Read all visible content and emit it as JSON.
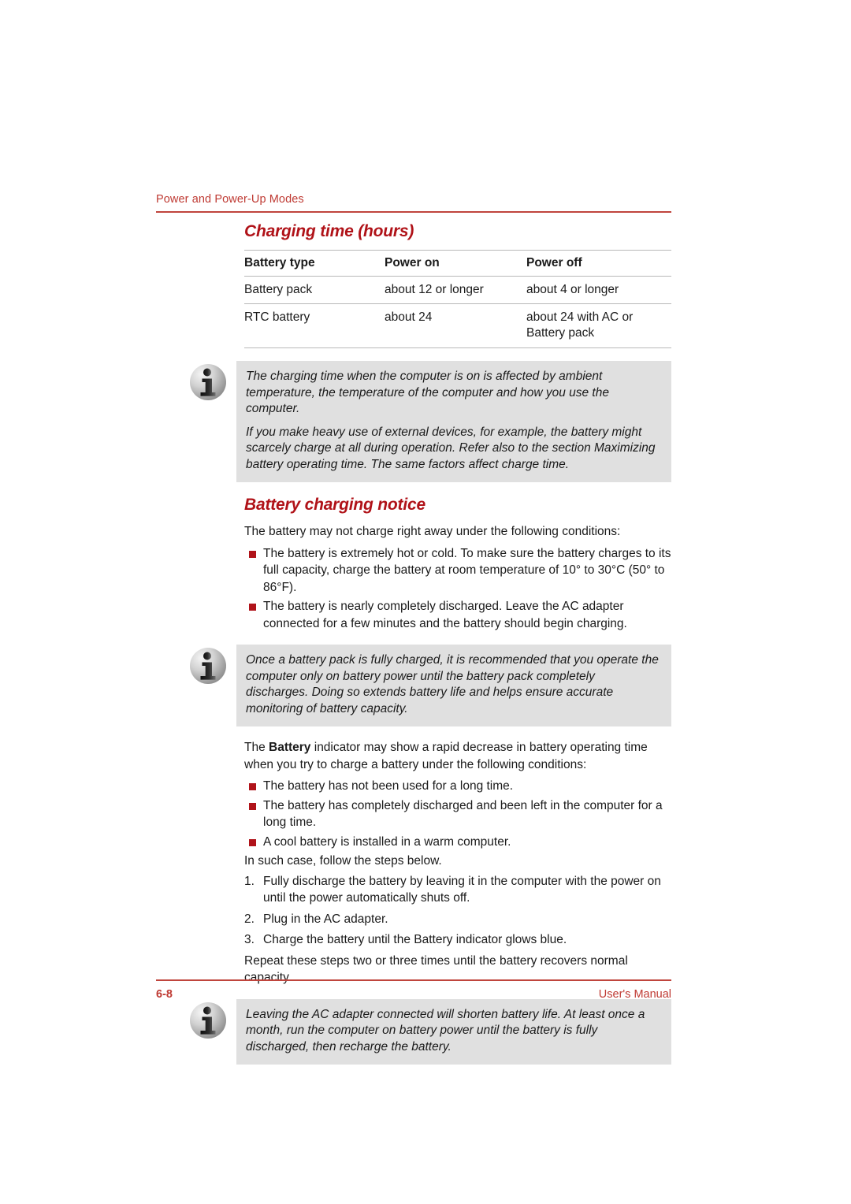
{
  "page": {
    "running_header": "Power and Power-Up Modes",
    "footer_page_number": "6-8",
    "footer_label": "User's Manual",
    "accent_red": "#b01218",
    "header_red": "#bf3a33",
    "bullet_red": "#b0131a",
    "note_background": "#e0e0e0"
  },
  "sections": {
    "charging_time": {
      "title": "Charging time (hours)",
      "table": {
        "headers": [
          "Battery type",
          "Power on",
          "Power off"
        ],
        "rows": [
          [
            "Battery pack",
            "about 12 or longer",
            "about 4 or longer"
          ],
          [
            "RTC battery",
            "about 24",
            "about 24 with AC or Battery pack"
          ]
        ]
      },
      "note": {
        "icon": "info-icon",
        "paragraphs": [
          "The charging time when the computer is on is affected by ambient temperature, the temperature of the computer and how you use the computer.",
          "If you make heavy use of external devices, for example, the battery might scarcely charge at all during operation. Refer also to the section Maximizing battery operating time. The same factors affect charge time."
        ]
      }
    },
    "battery_charging_notice": {
      "title": "Battery charging notice",
      "intro": "The battery may not charge right away under the following conditions:",
      "conditions": [
        "The battery is extremely hot or cold. To make sure the battery charges to its full capacity, charge the battery at room temperature of 10° to 30°C (50° to 86°F).",
        "The battery is nearly completely discharged. Leave the AC adapter connected for a few minutes and the battery should begin charging."
      ],
      "note": {
        "icon": "info-icon",
        "paragraphs": [
          "Once a battery pack is fully charged, it is recommended that you operate the computer only on battery power until the battery pack completely discharges. Doing so extends battery life and helps ensure accurate monitoring of battery capacity."
        ]
      },
      "indicator_paragraph_prefix": "The ",
      "indicator_paragraph_bold": "Battery",
      "indicator_paragraph_suffix": " indicator may show a rapid decrease in battery operating time when you try to charge a battery under the following conditions:",
      "indicator_conditions": [
        "The battery has not been used for a long time.",
        "The battery has completely discharged and been left in the computer for a long time.",
        "A cool battery is installed in a warm computer."
      ],
      "steps_intro": "In such case, follow the steps below.",
      "steps": [
        {
          "number": "1.",
          "text": "Fully discharge the battery by leaving it in the computer with the power on until the power automatically shuts off."
        },
        {
          "number": "2.",
          "text": "Plug in the AC adapter."
        },
        {
          "number": "3.",
          "text": "Charge the battery until the Battery indicator glows blue."
        }
      ],
      "closing": "Repeat these steps two or three times until the battery recovers normal capacity.",
      "final_note": {
        "icon": "info-icon",
        "paragraphs": [
          "Leaving the AC adapter connected will shorten battery life. At least once a month, run the computer on battery power until the battery is fully discharged, then recharge the battery."
        ]
      }
    }
  }
}
